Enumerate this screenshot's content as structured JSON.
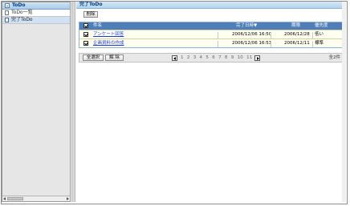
{
  "sidebar": {
    "header": "ToDo",
    "items": [
      {
        "label": "ToDo一覧"
      },
      {
        "label": "完了ToDo"
      }
    ]
  },
  "main": {
    "title": "完了ToDo",
    "delete_label": "削除",
    "columns": {
      "subject": "件名",
      "completed": "完了日時▼",
      "due": "期限",
      "priority": "優先度"
    },
    "rows": [
      {
        "subject": "アンケート回答",
        "completed": "2006/12/06 16:50",
        "due": "2006/12/28",
        "priority": "低い"
      },
      {
        "subject": "企画資料の作成",
        "completed": "2006/12/06 16:53",
        "due": "2006/12/11",
        "priority": "標準"
      }
    ],
    "select_all_label": "全選択",
    "clear_label": "解 除",
    "pages": [
      "1",
      "2",
      "3",
      "4",
      "5",
      "6",
      "7",
      "8",
      "9",
      "10",
      "11"
    ],
    "total": "全2件"
  }
}
